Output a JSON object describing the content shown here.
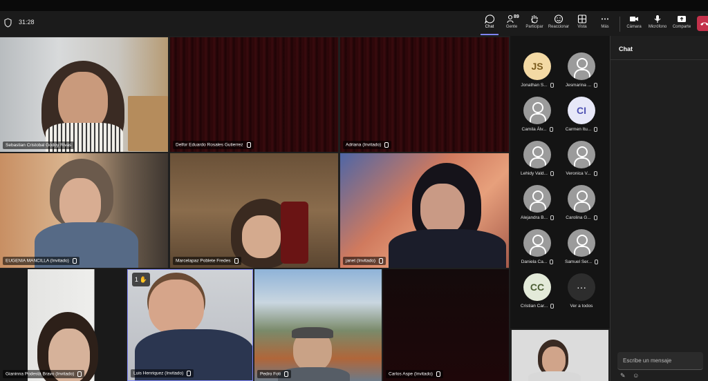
{
  "meeting": {
    "timer": "31:28"
  },
  "toolbar": {
    "chat": "Chat",
    "people": "Gente",
    "people_count": "89",
    "participate": "Participar",
    "reactions": "Reaccionar",
    "view": "Vista",
    "more": "Más",
    "camera": "Cámara",
    "mic": "Micrófono",
    "share": "Comparte"
  },
  "tiles": [
    "Sebastian Cristobal Godoy Rivas",
    "Delfor Eduardo Rosales Gutierrez",
    "Adriana (Invitado)",
    "EUGENIA MANCILLA (Invitado)",
    "Marcelapaz Poblete Fredes",
    "janet (Invitado)",
    "Gianinna Podestá Bravo (Invitado)",
    "Luis Henriquez (Invitado)",
    "Pedro Foti",
    "Carlos Aspe (Invitado)"
  ],
  "raised_hand": {
    "count": "1"
  },
  "roster": [
    {
      "initials": "JS",
      "name": "Jonathan S...",
      "color": "#f3d9a4"
    },
    {
      "initials": "",
      "name": "Jesmarina ...",
      "color": "#9b9b9b"
    },
    {
      "initials": "",
      "name": "Camila Álv...",
      "color": "#9b9b9b"
    },
    {
      "initials": "CI",
      "name": "Carmen Itu...",
      "color": "#e7e8f8"
    },
    {
      "initials": "",
      "name": "Lehidy Vald...",
      "color": "#9b9b9b"
    },
    {
      "initials": "",
      "name": "Veronica V...",
      "color": "#9b9b9b"
    },
    {
      "initials": "",
      "name": "Alejandra B...",
      "color": "#9b9b9b"
    },
    {
      "initials": "",
      "name": "Carolina G...",
      "color": "#9b9b9b"
    },
    {
      "initials": "",
      "name": "Daniela Ca...",
      "color": "#9b9b9b"
    },
    {
      "initials": "",
      "name": "Samuel Ser...",
      "color": "#9b9b9b"
    },
    {
      "initials": "CC",
      "name": "Cristian Car...",
      "color": "#e3ead9"
    }
  ],
  "see_all": "Ver a todos",
  "chat_panel": {
    "title": "Chat",
    "placeholder": "Escribe un mensaje"
  },
  "icons": {
    "more_dots": "more-dots-icon",
    "shield": "shield-icon"
  }
}
